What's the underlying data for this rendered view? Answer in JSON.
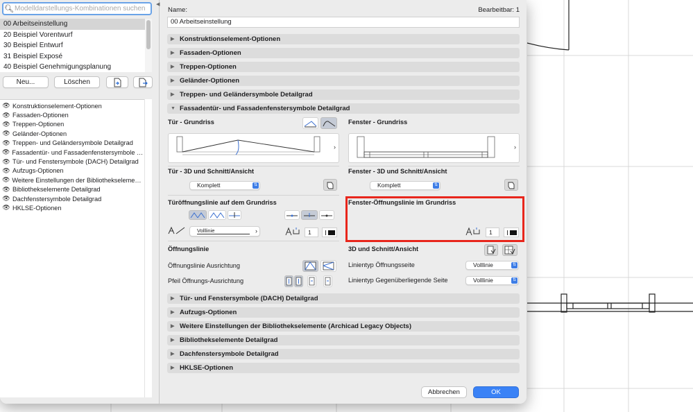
{
  "search": {
    "placeholder": "Modelldarstellungs-Kombinationen suchen"
  },
  "combinations": [
    {
      "label": "00 Arbeitseinstellung",
      "selected": true
    },
    {
      "label": "20 Beispiel Vorentwurf"
    },
    {
      "label": "30 Beispiel Entwurf"
    },
    {
      "label": "31 Beispiel Exposé"
    },
    {
      "label": "40 Beispiel Genehmigungsplanung"
    }
  ],
  "left_buttons": {
    "new": "Neu...",
    "delete": "Löschen",
    "import_icon": "import-icon",
    "export_icon": "export-icon"
  },
  "option_list": [
    "Konstruktionselement-Optionen",
    "Fassaden-Optionen",
    "Treppen-Optionen",
    "Geländer-Optionen",
    "Treppen- und Geländersymbole Detailgrad",
    "Fassadentür- und Fassadenfenstersymbole De...",
    "Tür- und Fenstersymbole (DACH) Detailgrad",
    "Aufzugs-Optionen",
    "Weitere Einstellungen der Bibliothekselemente...",
    "Bibliothekselemente Detailgrad",
    "Dachfenstersymbole Detailgrad",
    "HKLSE-Optionen"
  ],
  "header": {
    "name_label": "Name:",
    "editable": "Bearbeitbar: 1",
    "name_value": "00 Arbeitseinstellung"
  },
  "sections_top": [
    "Konstruktionselement-Optionen",
    "Fassaden-Optionen",
    "Treppen-Optionen",
    "Geländer-Optionen",
    "Treppen- und Geländersymbole Detailgrad"
  ],
  "expanded_section": "Fassadentür- und Fassadenfenstersymbole Detailgrad",
  "door": {
    "floorplan_title": "Tür - Grundriss",
    "section_title": "Tür - 3D und Schnitt/Ansicht",
    "section_value": "Komplett",
    "opening_title": "Türöffnungslinie auf dem Grundriss",
    "line_type": "Volllinie"
  },
  "window": {
    "floorplan_title": "Fenster - Grundriss",
    "section_title": "Fenster - 3D und Schnitt/Ansicht",
    "section_value": "Komplett",
    "opening_title": "Fenster-Öffnungslinie im Grundriss",
    "pen_number": "1"
  },
  "door_pen_number": "1",
  "opening_line": {
    "title": "Öffnungslinie",
    "alignment_label": "Öffnungslinie Ausrichtung",
    "arrow_label": "Pfeil Öffnungs-Ausrichtung"
  },
  "section_3d": {
    "title": "3D und Schnitt/Ansicht",
    "linetype_opening_label": "Linientyp Öffnungsseite",
    "linetype_opening_value": "Volllinie",
    "linetype_opposite_label": "Linientyp Gegenüberliegende Seite",
    "linetype_opposite_value": "Volllinie"
  },
  "sections_bottom": [
    "Tür- und Fenstersymbole (DACH) Detailgrad",
    "Aufzugs-Optionen",
    "Weitere Einstellungen der Bibliothekselemente (Archicad Legacy Objects)",
    "Bibliothekselemente Detailgrad",
    "Dachfenstersymbole Detailgrad",
    "HKLSE-Optionen"
  ],
  "footer": {
    "cancel": "Abbrechen",
    "ok": "OK"
  },
  "colors": {
    "accent": "#3a82f6",
    "highlight": "#e8261c",
    "selection": "#d5d5d5"
  }
}
